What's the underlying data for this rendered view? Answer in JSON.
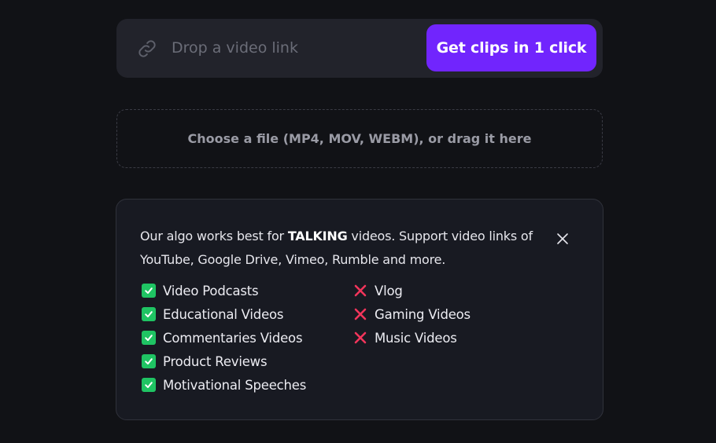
{
  "url_bar": {
    "link_icon": "link-icon",
    "placeholder": "Drop a video link",
    "button_label": "Get clips in 1 click",
    "accent_color": "#7125fd"
  },
  "dropzone": {
    "label": "Choose a file (MP4, MOV, WEBM), or drag it here"
  },
  "info": {
    "text_before": "Our algo works best for ",
    "text_bold": "TALKING",
    "text_after": " videos. Support video links of YouTube, Google Drive, Vimeo, Rumble and more.",
    "close_icon": "close-icon",
    "supported": [
      "Video Podcasts",
      "Educational Videos",
      "Commentaries Videos",
      "Product Reviews",
      "Motivational Speeches"
    ],
    "unsupported": [
      "Vlog",
      "Gaming Videos",
      "Music Videos"
    ],
    "check_color": "#1fc463",
    "cross_color": "#f2355b"
  }
}
